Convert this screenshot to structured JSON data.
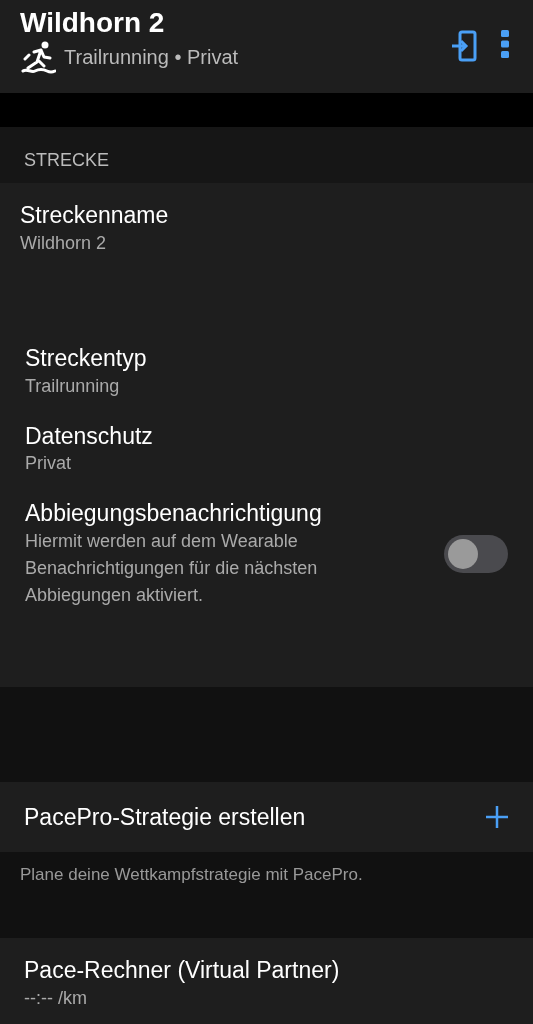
{
  "header": {
    "title": "Wildhorn 2",
    "subtitle": "Trailrunning • Privat"
  },
  "section": {
    "title": "STRECKE",
    "items": [
      {
        "kind": "field",
        "label": "Streckenname",
        "value": "Wildhorn 2"
      },
      {
        "kind": "field",
        "label": "Streckentyp",
        "value": "Trailrunning"
      },
      {
        "kind": "field",
        "label": "Datenschutz",
        "value": "Privat"
      },
      {
        "kind": "toggle",
        "label": "Abbiegungsbenachrichtigung",
        "value": "Hiermit werden auf dem Wearable Benachrichtigungen für die nächsten Abbiegungen aktiviert.",
        "on": false
      }
    ]
  },
  "pacepro": {
    "label": "PacePro-Strategie erstellen",
    "note": "Plane deine Wettkampfstrategie mit PacePro."
  },
  "pace_calculator": {
    "label": "Pace-Rechner (Virtual Partner)",
    "value": "--:-- /km"
  }
}
